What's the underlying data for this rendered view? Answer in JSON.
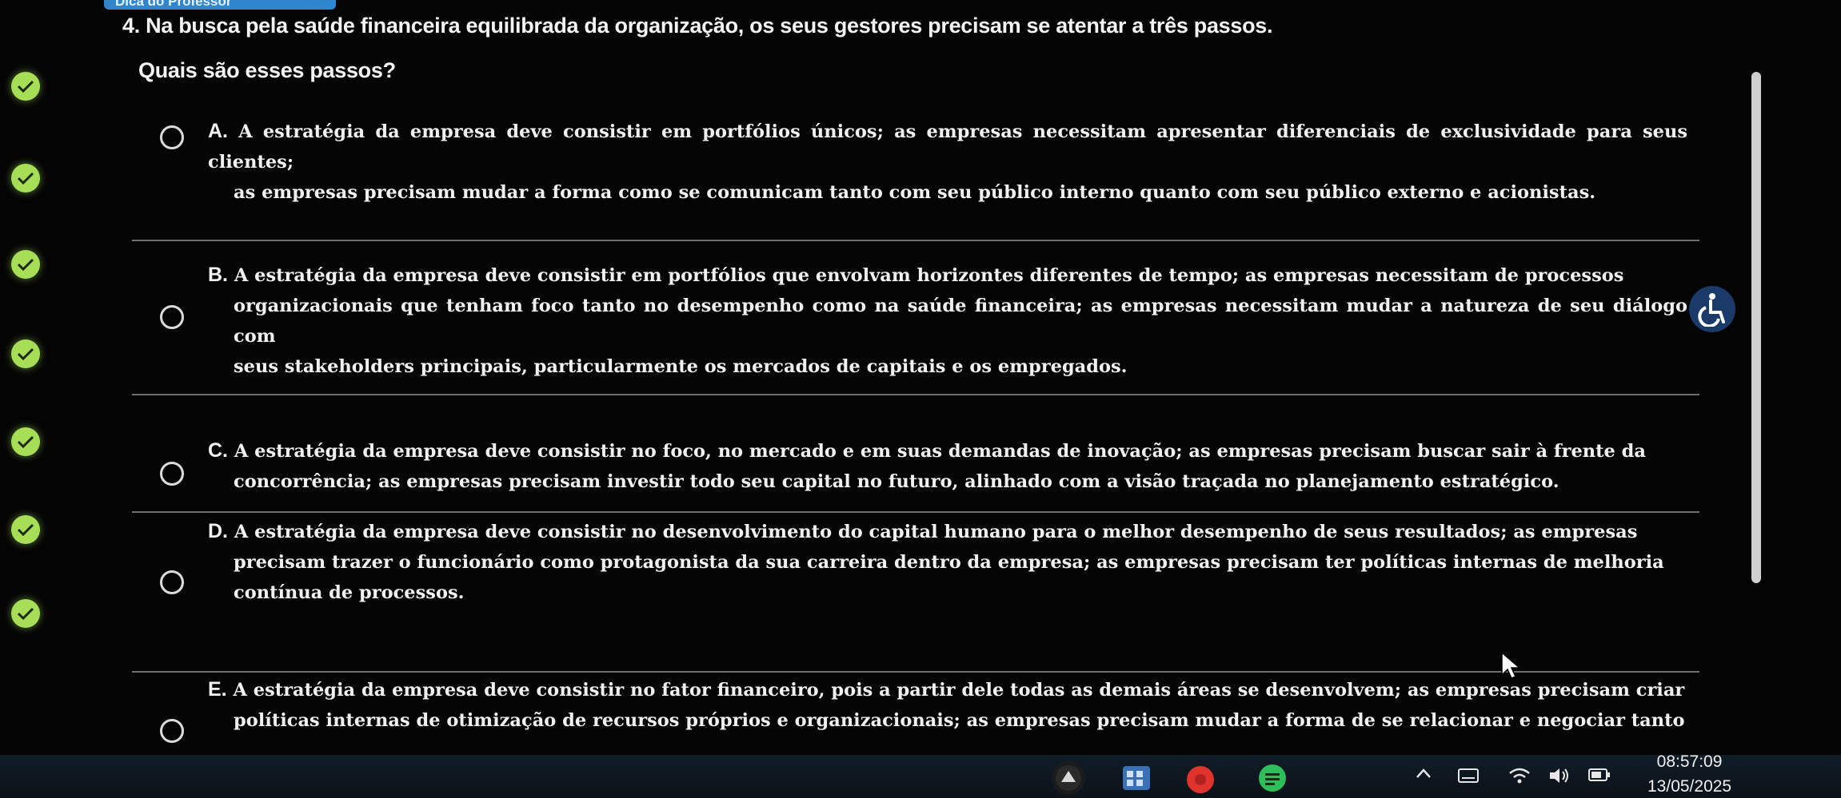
{
  "hint": {
    "label": "Dica do Professor"
  },
  "question": {
    "number": "4.",
    "text": "Na busca pela saúde financeira equilibrada da organização, os seus gestores precisam se atentar a três passos.",
    "subtext": "Quais são esses passos?"
  },
  "options": [
    {
      "letter": "A.",
      "lines": [
        "A estratégia da empresa deve consistir em portfólios únicos; as empresas necessitam apresentar diferenciais de exclusividade para seus clientes;",
        "as empresas precisam mudar a forma como se comunicam tanto com seu público interno quanto com seu público externo e acionistas."
      ]
    },
    {
      "letter": "B.",
      "lines": [
        "A estratégia da empresa deve consistir em portfólios que envolvam horizontes diferentes de tempo; as empresas necessitam de processos",
        "organizacionais que tenham foco tanto no desempenho como na saúde financeira; as empresas necessitam mudar a natureza de seu diálogo com",
        "seus stakeholders principais, particularmente os mercados de capitais e os empregados."
      ]
    },
    {
      "letter": "C.",
      "lines": [
        "A estratégia da empresa deve consistir no foco, no mercado e em suas demandas de inovação; as empresas precisam buscar sair à frente da",
        "concorrência; as empresas precisam investir todo seu capital no futuro, alinhado com a visão traçada no planejamento estratégico."
      ]
    },
    {
      "letter": "D.",
      "lines": [
        "A estratégia da empresa deve consistir no desenvolvimento do capital humano para o melhor desempenho de seus resultados; as empresas",
        "precisam trazer o funcionário como protagonista da sua carreira dentro da empresa; as empresas precisam ter políticas internas de melhoria",
        "contínua de processos."
      ]
    },
    {
      "letter": "E.",
      "lines": [
        "A estratégia da empresa deve consistir no fator financeiro, pois a partir dele todas as demais áreas se desenvolvem; as empresas precisam criar",
        "políticas internas de otimização de recursos próprios e organizacionais; as empresas precisam mudar a forma de se relacionar e negociar tanto"
      ]
    }
  ],
  "taskbar": {
    "time": "08:57:09",
    "date": "13/05/2025"
  },
  "colors": {
    "background": "#050505",
    "check": "#a6df56",
    "hint_tab": "#2f86cf",
    "taskbar": "#0f1820"
  }
}
